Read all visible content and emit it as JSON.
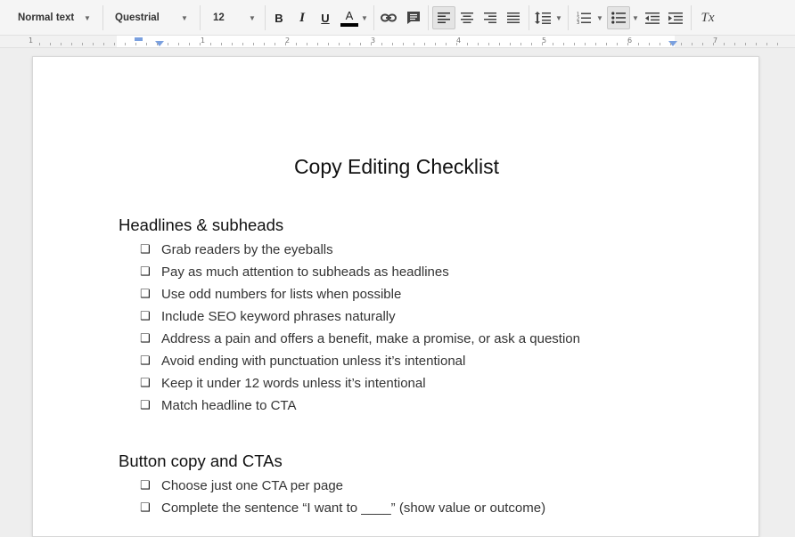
{
  "toolbar": {
    "style_label": "Normal text",
    "font_label": "Questrial",
    "size_label": "12",
    "bold_label": "B",
    "italic_label": "I",
    "underline_label": "U",
    "text_color_label": "A",
    "clear_format_label": "Tx",
    "text_color": "#000000"
  },
  "ruler": {
    "numbers": [
      "1",
      "1",
      "2",
      "3",
      "4",
      "5",
      "6",
      "7"
    ]
  },
  "document": {
    "title": "Copy Editing Checklist",
    "sections": [
      {
        "heading": "Headlines & subheads",
        "items": [
          "Grab readers by the eyeballs",
          "Pay as much attention to subheads as headlines",
          "Use odd numbers for lists when possible",
          "Include SEO keyword phrases naturally",
          "Address a pain and offers a benefit, make a promise, or ask a question",
          "Avoid ending with punctuation unless it’s intentional",
          "Keep it under 12 words unless it’s intentional",
          "Match headline to CTA"
        ]
      },
      {
        "heading": "Button copy and CTAs",
        "items": [
          "Choose just one CTA per page",
          "Complete the sentence “I want to ____” (show value or outcome)"
        ]
      }
    ]
  },
  "icons": {
    "checkbox": "❑",
    "caret": "▼"
  }
}
